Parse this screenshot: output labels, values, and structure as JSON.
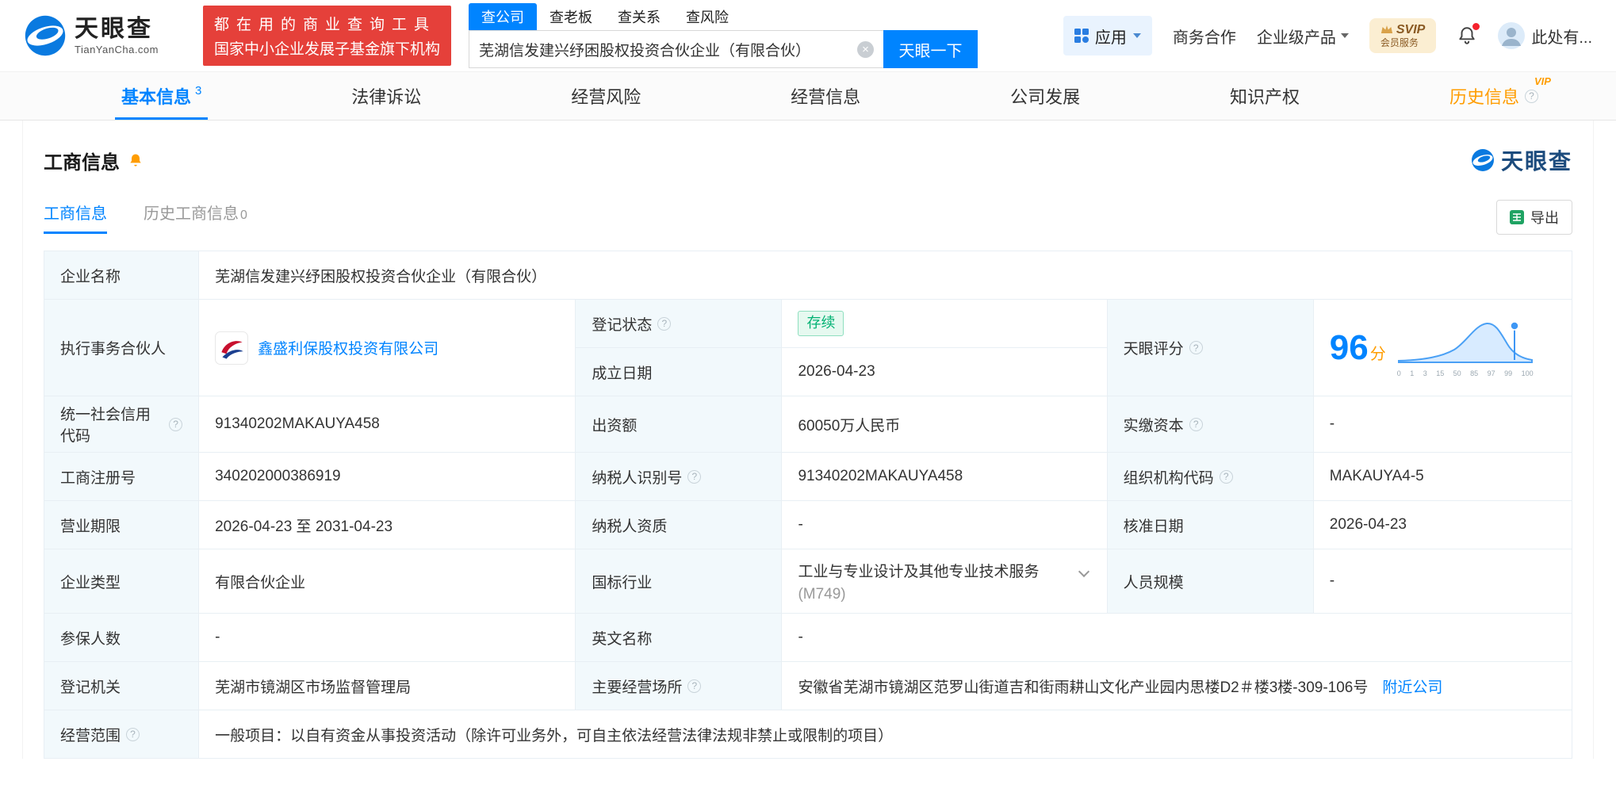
{
  "colors": {
    "brand_blue": "#0084ff",
    "badge_red": "#e5403a",
    "vip_orange": "#ff9d00",
    "status_green": "#00b173",
    "label_bg": "#f2f9fc"
  },
  "header": {
    "brand": "天眼查",
    "brand_domain": "TianYanCha.com",
    "slogan_line1": "都在用的商业查询工具",
    "slogan_line2": "国家中小企业发展子基金旗下机构",
    "search_tabs": [
      {
        "label": "查公司"
      },
      {
        "label": "查老板"
      },
      {
        "label": "查关系"
      },
      {
        "label": "查风险"
      }
    ],
    "search_value": "芜湖信发建兴纾困股权投资合伙企业（有限合伙）",
    "search_button": "天眼一下",
    "apps_label": "应用",
    "biz_coop": "商务合作",
    "enterprise_products": "企业级产品",
    "svip_title": "SVIP",
    "svip_subtitle": "会员服务",
    "username": "此处有..."
  },
  "nav_tabs": [
    {
      "label": "基本信息",
      "count": "3"
    },
    {
      "label": "法律诉讼"
    },
    {
      "label": "经营风险"
    },
    {
      "label": "经营信息"
    },
    {
      "label": "公司发展"
    },
    {
      "label": "知识产权"
    },
    {
      "label": "历史信息",
      "badge": "VIP"
    }
  ],
  "section": {
    "title": "工商信息",
    "watermark_brand": "天眼查",
    "subtab_active": "工商信息",
    "subtab_history": "历史工商信息",
    "subtab_history_count": "0",
    "export_label": "导出"
  },
  "biz": {
    "company_name": {
      "label": "企业名称",
      "value": "芜湖信发建兴纾困股权投资合伙企业（有限合伙）"
    },
    "partner": {
      "label": "执行事务合伙人",
      "value": "鑫盛利保股权投资有限公司"
    },
    "reg_status": {
      "label": "登记状态",
      "value": "存续"
    },
    "establish_date": {
      "label": "成立日期",
      "value": "2026-04-23"
    },
    "score": {
      "label": "天眼评分"
    },
    "credit_code": {
      "label": "统一社会信用代码",
      "value": "91340202MAKAUYA458"
    },
    "capital": {
      "label": "出资额",
      "value": "60050万人民币"
    },
    "paid_capital": {
      "label": "实缴资本",
      "value": "-"
    },
    "reg_number": {
      "label": "工商注册号",
      "value": "340202000386919"
    },
    "taxpayer_id": {
      "label": "纳税人识别号",
      "value": "91340202MAKAUYA458"
    },
    "org_code": {
      "label": "组织机构代码",
      "value": "MAKAUYA4-5"
    },
    "business_term": {
      "label": "营业期限",
      "value": "2026-04-23 至 2031-04-23"
    },
    "taxpayer_qualification": {
      "label": "纳税人资质",
      "value": "-"
    },
    "approval_date": {
      "label": "核准日期",
      "value": "2026-04-23"
    },
    "company_type": {
      "label": "企业类型",
      "value": "有限合伙企业"
    },
    "industry": {
      "label": "国标行业",
      "value": "工业与专业设计及其他专业技术服务",
      "code": "(M749)"
    },
    "staff_size": {
      "label": "人员规模",
      "value": "-"
    },
    "insured_count": {
      "label": "参保人数",
      "value": "-"
    },
    "english_name": {
      "label": "英文名称",
      "value": "-"
    },
    "reg_authority": {
      "label": "登记机关",
      "value": "芜湖市镜湖区市场监督管理局"
    },
    "business_address": {
      "label": "主要经营场所",
      "value": "安徽省芜湖市镜湖区范罗山街道吉和街雨耕山文化产业园内思楼D2＃楼3楼-309-106号",
      "link": "附近公司"
    },
    "business_scope": {
      "label": "经营范围",
      "value": "一般项目：以自有资金从事投资活动（除许可业务外，可自主依法经营法律法规非禁止或限制的项目）"
    }
  },
  "score_chart": {
    "type": "line",
    "value": 96,
    "unit": "分",
    "x_ticks": [
      "0",
      "1",
      "3",
      "15",
      "50",
      "85",
      "97",
      "99",
      "100"
    ],
    "marker_at": "97"
  }
}
